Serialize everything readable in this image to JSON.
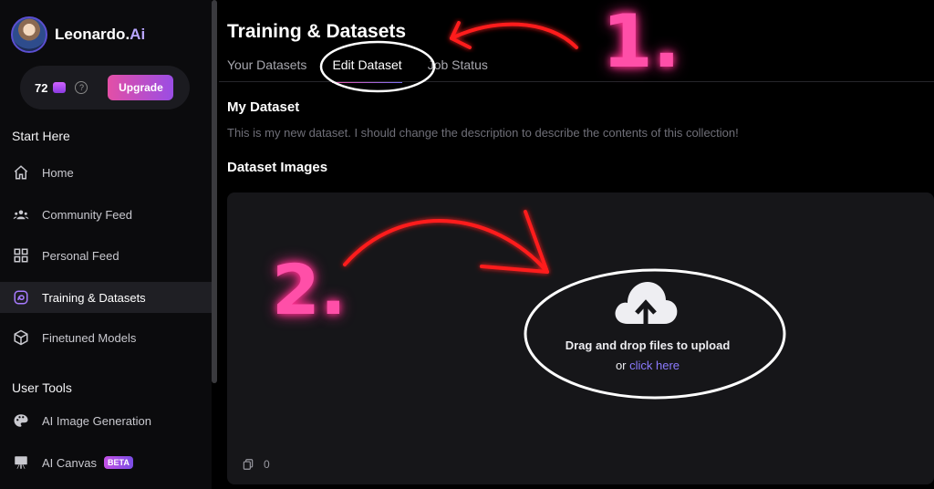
{
  "app": {
    "brand_name": "Leonardo.",
    "brand_suffix": "Ai"
  },
  "credits": {
    "count": "72",
    "upgrade_label": "Upgrade"
  },
  "sidebar": {
    "start_here_title": "Start Here",
    "start_items": [
      {
        "label": "Home",
        "icon": "home-icon"
      },
      {
        "label": "Community Feed",
        "icon": "community-icon"
      },
      {
        "label": "Personal Feed",
        "icon": "grid-icon"
      },
      {
        "label": "Training & Datasets",
        "icon": "training-icon",
        "active": true
      },
      {
        "label": "Finetuned Models",
        "icon": "cube-icon"
      }
    ],
    "user_tools_title": "User Tools",
    "tool_items": [
      {
        "label": "AI Image Generation",
        "icon": "palette-icon"
      },
      {
        "label": "AI Canvas",
        "icon": "canvas-icon",
        "badge": "BETA"
      }
    ]
  },
  "main": {
    "title": "Training & Datasets",
    "tabs": [
      {
        "label": "Your Datasets"
      },
      {
        "label": "Edit Dataset",
        "active": true
      },
      {
        "label": "Job Status"
      }
    ],
    "dataset_name": "My Dataset",
    "dataset_description": "This is my new dataset. I should change the description to describe the contents of this collection!",
    "images_title": "Dataset Images",
    "upload": {
      "text": "Drag and drop files to upload",
      "or": "or",
      "link": "click here"
    },
    "file_count": "0"
  },
  "annotations": {
    "step1": "1.",
    "step2": "2."
  },
  "colors": {
    "accent_pink": "#ff4fa8",
    "annotation_red": "#ff1f1f",
    "link": "#8c7bff"
  }
}
